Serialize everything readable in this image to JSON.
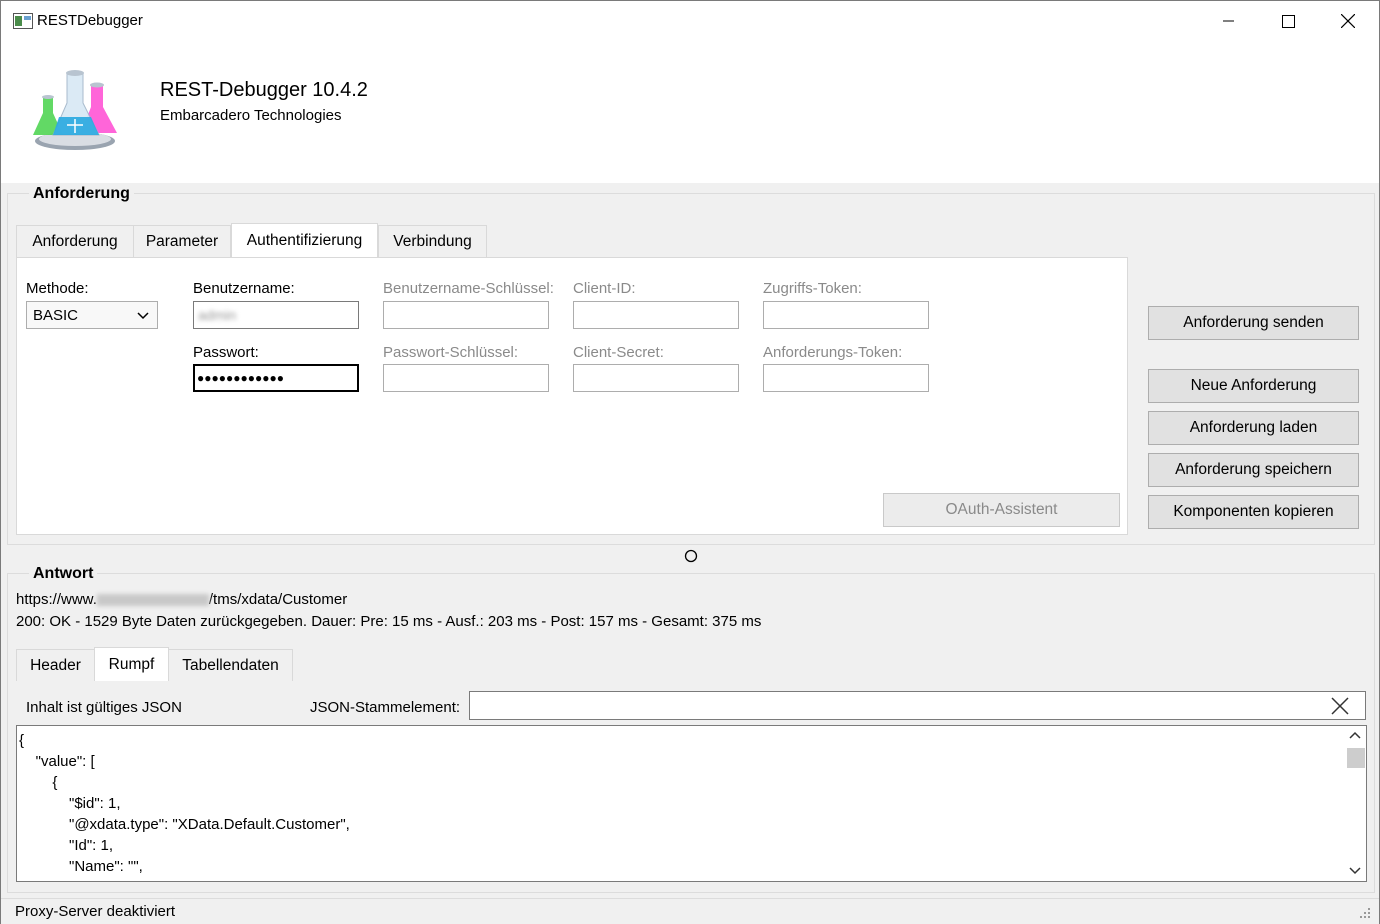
{
  "window": {
    "title": "RESTDebugger"
  },
  "header": {
    "app_name": "REST-Debugger 10.4.2",
    "vendor": "Embarcadero Technologies"
  },
  "request": {
    "group_title": "Anforderung",
    "tabs": [
      {
        "label": "Anforderung",
        "active": false
      },
      {
        "label": "Parameter",
        "active": false
      },
      {
        "label": "Authentifizierung",
        "active": true
      },
      {
        "label": "Verbindung",
        "active": false
      }
    ],
    "auth": {
      "method_label": "Methode:",
      "method_value": "BASIC",
      "username_label": "Benutzername:",
      "username_value": "admin",
      "password_label": "Passwort:",
      "password_value": "●●●●●●●●●●●●",
      "username_key_label": "Benutzername-Schlüssel:",
      "password_key_label": "Passwort-Schlüssel:",
      "client_id_label": "Client-ID:",
      "client_secret_label": "Client-Secret:",
      "access_token_label": "Zugriffs-Token:",
      "request_token_label": "Anforderungs-Token:",
      "oauth_button": "OAuth-Assistent"
    },
    "buttons": {
      "send": "Anforderung senden",
      "new": "Neue Anforderung",
      "load": "Anforderung laden",
      "save": "Anforderung speichern",
      "copy": "Komponenten kopieren"
    }
  },
  "response": {
    "group_title": "Antwort",
    "url_prefix": "https://www.",
    "url_suffix": "/tms/xdata/Customer",
    "status": "200: OK - 1529 Byte Daten zurückgegeben. Dauer: Pre: 15 ms - Ausf.: 203 ms - Post: 157 ms - Gesamt: 375 ms",
    "tabs": [
      {
        "label": "Header",
        "active": false
      },
      {
        "label": "Rumpf",
        "active": true
      },
      {
        "label": "Tabellendaten",
        "active": false
      }
    ],
    "json_valid": "Inhalt ist gültiges JSON",
    "json_root_label": "JSON-Stammelement:",
    "json_root_value": "",
    "body": "{\n    \"value\": [\n        {\n            \"$id\": 1,\n            \"@xdata.type\": \"XData.Default.Customer\",\n            \"Id\": 1,\n            \"Name\": \"\","
  },
  "statusbar": {
    "text": "Proxy-Server deaktiviert"
  }
}
